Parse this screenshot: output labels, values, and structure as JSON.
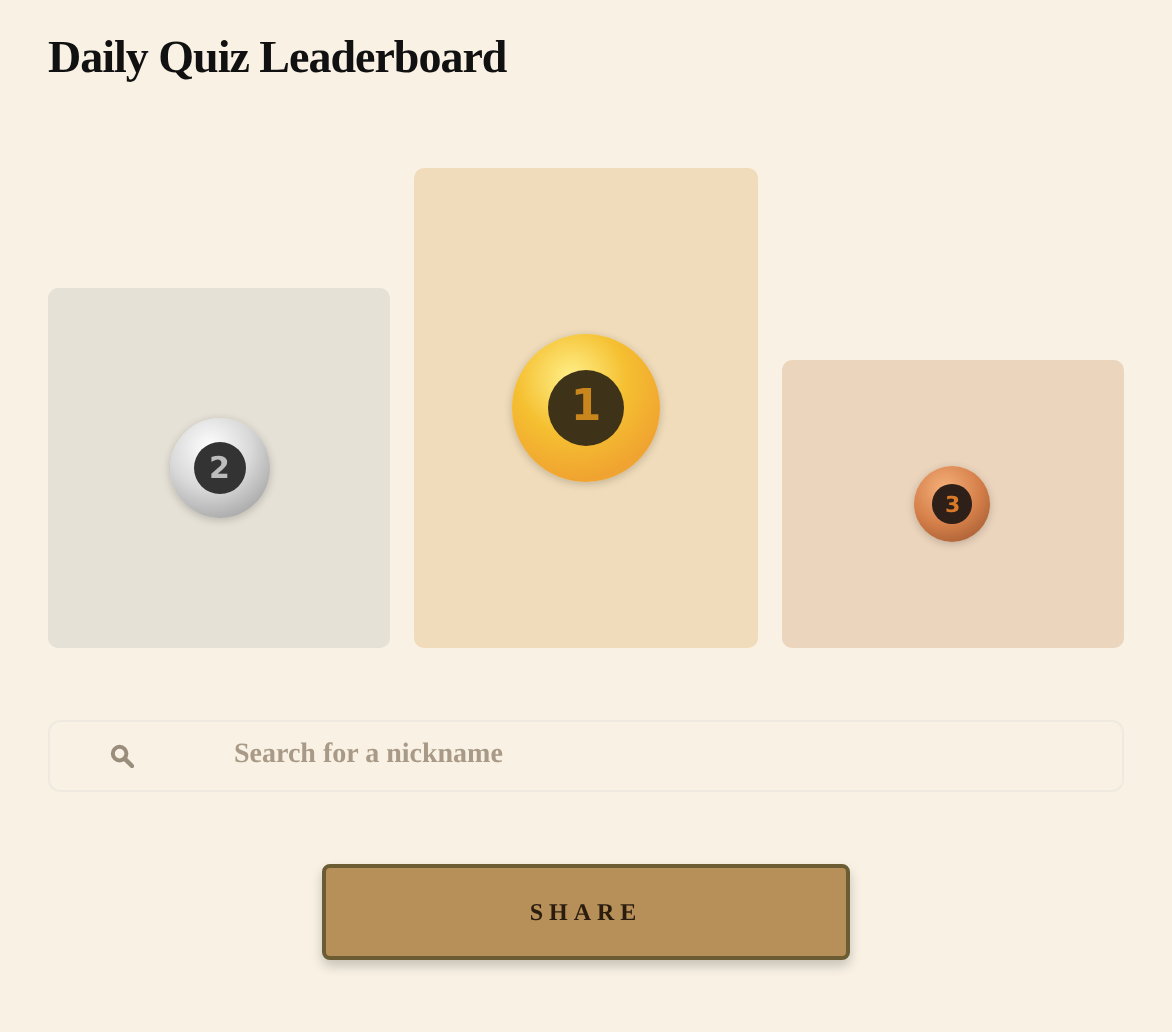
{
  "title": "Daily Quiz Leaderboard",
  "podium": [
    {
      "rank": "2",
      "kind": "silver"
    },
    {
      "rank": "1",
      "kind": "gold"
    },
    {
      "rank": "3",
      "kind": "bronze"
    }
  ],
  "search": {
    "placeholder": "Search for a nickname"
  },
  "share_button": "SHARE"
}
